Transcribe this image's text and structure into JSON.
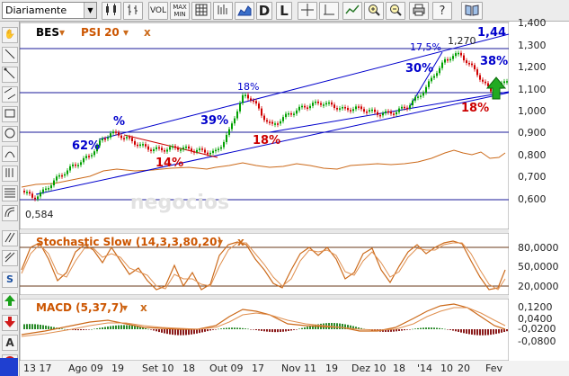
{
  "toolbar": {
    "period_select": "Diariamente",
    "vol_label": "VOL",
    "max_label": "MAX",
    "min_label": "MIN",
    "d_label": "D",
    "l_label": "L"
  },
  "main_panel": {
    "symbol": "BES",
    "indicator": "PSI 20",
    "close_mark": "x",
    "dropdown_mark": "▾",
    "watermark": "negocios",
    "y_ticks": [
      "1,400",
      "1,300",
      "1,200",
      "1,100",
      "1,000",
      "0,900",
      "0,800",
      "0,700",
      "0,600"
    ],
    "annotations": {
      "pct_a": "%",
      "pct_62": "62%",
      "pct_14": "14%",
      "pct_39": "39%",
      "pct_18a": "18%",
      "pct_18b": "18%",
      "pct_30": "30%",
      "pct_175": "17,5%",
      "val_1270": "1,270",
      "pct_38": "38%",
      "val_144": "1,44",
      "pct_18c": "18%",
      "val_0584": "0,584"
    }
  },
  "stochastic_panel": {
    "label": "Stochastic Slow (14,3,3,80,20)",
    "y_ticks": [
      "80,0000",
      "50,0000",
      "20,0000"
    ]
  },
  "macd_panel": {
    "label": "MACD (5,37,7)",
    "y_ticks": [
      "0,1200",
      "0,0400",
      "-0,0200",
      "-0,0800"
    ]
  },
  "x_axis": {
    "labels": [
      "13 17",
      "Ago 09",
      "19",
      "Set 10",
      "18",
      "Out 09",
      "17",
      "Nov 11",
      "19",
      "Dez 10",
      "18",
      "'14",
      "10",
      "20",
      "Fev"
    ]
  },
  "colors": {
    "price_up": "#00a000",
    "price_down": "#d00000",
    "channel_line": "#0000cc",
    "psi_line": "#cc6a1a",
    "pct_blue": "#0000cc",
    "pct_red": "#cc0000",
    "indicator_label": "#cc5500"
  }
}
